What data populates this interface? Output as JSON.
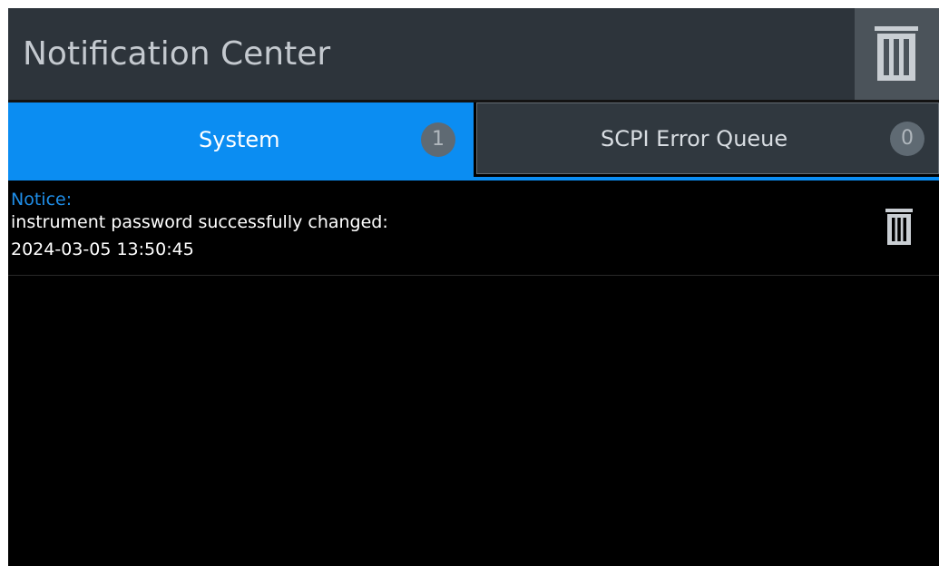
{
  "header": {
    "title": "Notification Center",
    "clear_all_icon": "trash-icon"
  },
  "tabs": [
    {
      "label": "System",
      "count": "1",
      "active": true
    },
    {
      "label": "SCPI Error Queue",
      "count": "0",
      "active": false
    }
  ],
  "notifications": [
    {
      "type": "Notice:",
      "message": "instrument password successfully changed:",
      "timestamp": "2024-03-05 13:50:45",
      "delete_icon": "trash-icon"
    }
  ],
  "colors": {
    "accent": "#0b8df2",
    "header_bg": "#2d343b",
    "notice_label": "#1f8ee8",
    "content_bg": "#000000"
  }
}
